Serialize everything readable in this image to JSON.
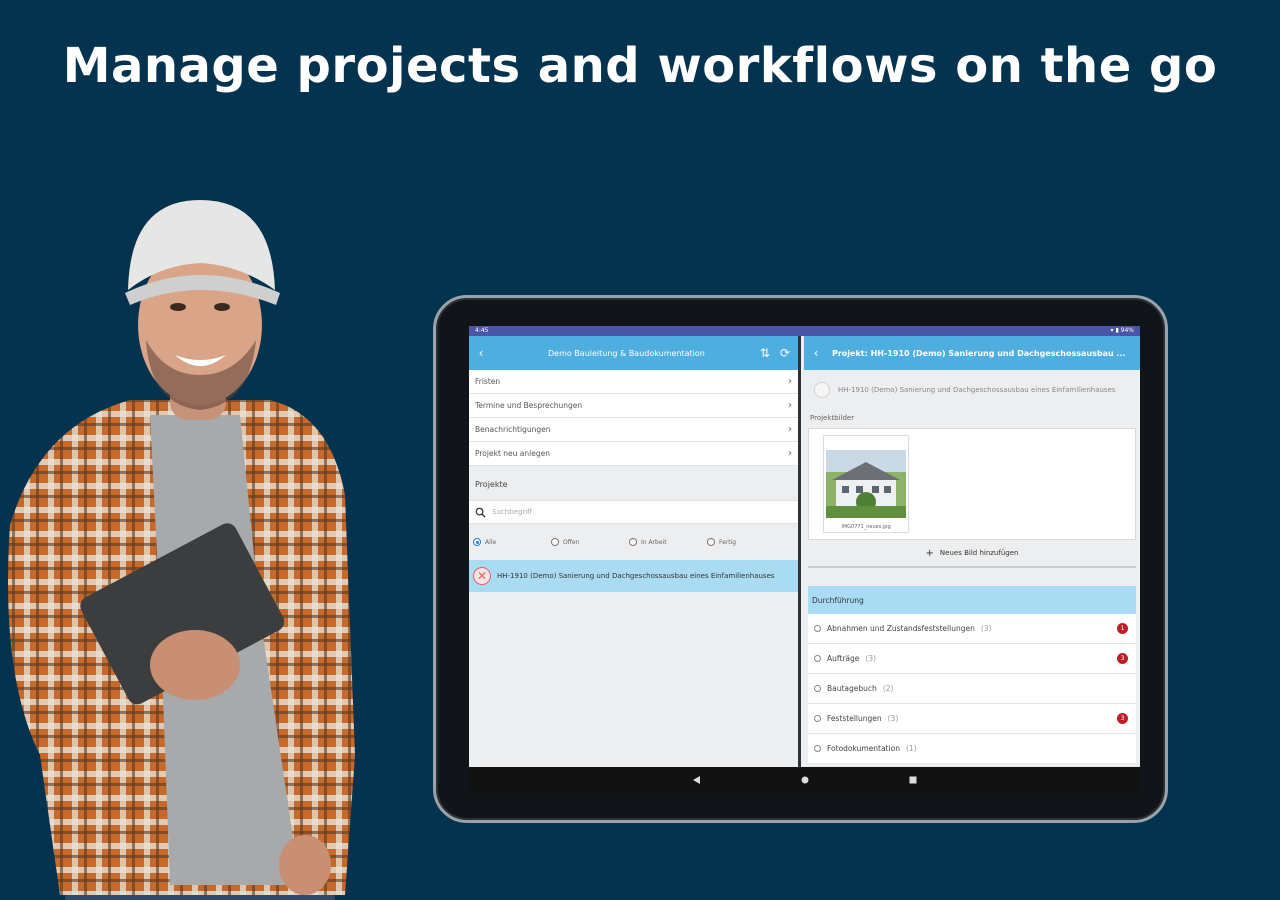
{
  "headline": "Manage projects and workflows on the go",
  "status_bar": {
    "time": "4:45",
    "icons": "▾ ▮ 94%"
  },
  "left_pane": {
    "title": "Demo Bauleitung & Baudokumentation",
    "menu_items": [
      {
        "label": "Fristen"
      },
      {
        "label": "Termine und Besprechungen"
      },
      {
        "label": "Benachrichtigungen"
      },
      {
        "label": "Projekt neu anlegen"
      }
    ],
    "projects_header": "Projekte",
    "search_placeholder": "Suchbegriff",
    "filters": [
      {
        "label": "Alle",
        "selected": true
      },
      {
        "label": "Offen",
        "selected": false
      },
      {
        "label": "In Arbeit",
        "selected": false
      },
      {
        "label": "Fertig",
        "selected": false
      }
    ],
    "project_item": "HH-1910 (Demo) Sanierung und Dachgeschossausbau eines Einfamilienhauses"
  },
  "right_pane": {
    "title": "Projekt: HH-1910 (Demo) Sanierung und Dachgeschossausbau ...",
    "project_name": "HH-1910 (Demo) Sanierung und Dachgeschossausbau eines Einfamilienhauses",
    "images_label": "Projektbilder",
    "image_caption": "IMG0771_neues.jpg",
    "add_image_label": "Neues Bild hinzufügen",
    "group_label": "Durchführung",
    "items": [
      {
        "label": "Abnahmen und Zustandsfeststellungen",
        "count": "(3)",
        "badge": "1"
      },
      {
        "label": "Aufträge",
        "count": "(3)",
        "badge": "3"
      },
      {
        "label": "Bautagebuch",
        "count": "(2)",
        "badge": ""
      },
      {
        "label": "Feststellungen",
        "count": "(3)",
        "badge": "3"
      },
      {
        "label": "Fotodokumentation",
        "count": "(1)",
        "badge": ""
      }
    ]
  },
  "colors": {
    "background": "#04334f",
    "appbar": "#4eaee0",
    "selection": "#a9dcf2",
    "badge": "#c01e25"
  }
}
